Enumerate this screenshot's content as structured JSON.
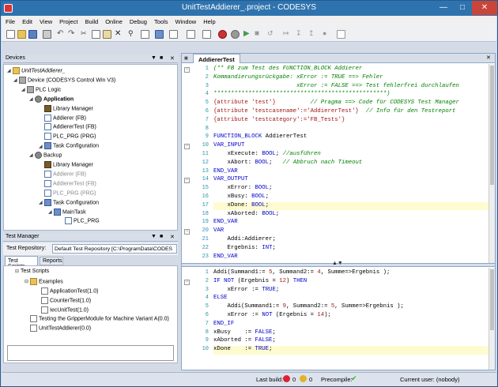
{
  "window": {
    "title": "UnitTestAddierer_.project - CODESYS"
  },
  "menu": [
    "File",
    "Edit",
    "View",
    "Project",
    "Build",
    "Online",
    "Debug",
    "Tools",
    "Window",
    "Help"
  ],
  "devices": {
    "title": "Devices",
    "items": [
      {
        "label": "UnitTestAddierer_",
        "icon": "project-icon",
        "italic": true
      },
      {
        "label": "Device (CODESYS Control Win V3)",
        "icon": "device-icon"
      },
      {
        "label": "PLC Logic",
        "icon": "plc-logic-icon"
      },
      {
        "label": "Application",
        "icon": "gear-icon",
        "bold": true
      },
      {
        "label": "Library Manager",
        "icon": "library-icon"
      },
      {
        "label": "Addierer (FB)",
        "icon": "pou-icon"
      },
      {
        "label": "AddiererTest (FB)",
        "icon": "pou-icon"
      },
      {
        "label": "PLC_PRG (PRG)",
        "icon": "pou-icon"
      },
      {
        "label": "Task Configuration",
        "icon": "task-icon"
      },
      {
        "label": "Backup",
        "icon": "gear-icon"
      },
      {
        "label": "Library Manager",
        "icon": "library-icon"
      },
      {
        "label": "Addierer (FB)",
        "icon": "pou-icon",
        "grey": true
      },
      {
        "label": "AddiererTest (FB)",
        "icon": "pou-icon",
        "grey": true
      },
      {
        "label": "PLC_PRG (PRG)",
        "icon": "pou-icon",
        "grey": true
      },
      {
        "label": "Task Configuration",
        "icon": "task-icon"
      },
      {
        "label": "MainTask",
        "icon": "task-icon"
      },
      {
        "label": "PLC_PRG",
        "icon": "pou-icon"
      }
    ]
  },
  "test_manager": {
    "title": "Test Manager",
    "repo_label": "Test Repository:",
    "repo_value": "Default Test Repository [C:\\ProgramData\\CODES",
    "tabs": [
      "Test Scripts",
      "Reports"
    ],
    "items": [
      {
        "label": "Test Scripts"
      },
      {
        "label": "Examples"
      },
      {
        "label": "ApplicationTest(1.0)"
      },
      {
        "label": "CounterTest(1.0)"
      },
      {
        "label": "IecUnitTest(1.0)"
      },
      {
        "label": "Testing the GripperModule for Machine Variant A(0.0)"
      },
      {
        "label": "UnitTestAddierer(0.0)"
      }
    ]
  },
  "editor": {
    "tab": "AddiererTest",
    "decl_lines": [
      {
        "n": "1",
        "html": "<span class='cmt'>(** FB zum Test des FUNCTION_BLOCK Addierer</span>"
      },
      {
        "n": "2",
        "html": "<span class='cmt'>Kommandierungsrückgabe: xError := TRUE ==> Fehler</span>"
      },
      {
        "n": "3",
        "html": "<span class='cmt'>                        xError := FALSE ==> Test fehlerfrei durchlaufen</span>"
      },
      {
        "n": "4",
        "html": "<span class='cmt'>**************************************************)</span>"
      },
      {
        "n": "5",
        "html": "<span class='str'>{attribute 'test'}</span>          <span class='cmt'>// Pragma ==> Code für CODESYS Test Manager</span>"
      },
      {
        "n": "6",
        "html": "<span class='str'>{attribute 'testcasename':='AddiererTest'}</span>  <span class='cmt'>// Info für den Testreport</span>"
      },
      {
        "n": "7",
        "html": "<span class='str'>{attribute 'testcategory':='FB_Tests'}</span>"
      },
      {
        "n": "8",
        "html": ""
      },
      {
        "n": "9",
        "html": "<span class='kw'>FUNCTION_BLOCK</span> AddiererTest"
      },
      {
        "n": "10",
        "html": "<span class='kw'>VAR_INPUT</span>"
      },
      {
        "n": "11",
        "html": "    xExecute: <span class='kw'>BOOL</span>; <span class='cmt'>//ausführen</span>"
      },
      {
        "n": "12",
        "html": "    xAbort: <span class='kw'>BOOL</span>;   <span class='cmt'>// Abbruch nach Timeout</span>"
      },
      {
        "n": "13",
        "html": "<span class='kw'>END_VAR</span>"
      },
      {
        "n": "14",
        "html": "<span class='kw'>VAR_OUTPUT</span>"
      },
      {
        "n": "15",
        "html": "    xError: <span class='kw'>BOOL</span>;"
      },
      {
        "n": "16",
        "html": "    xBusy: <span class='kw'>BOOL</span>;"
      },
      {
        "n": "17",
        "html": "    xDone: <span class='kw'>BOOL</span>;",
        "hl": true
      },
      {
        "n": "18",
        "html": "    xAborted: <span class='kw'>BOOL</span>;"
      },
      {
        "n": "19",
        "html": "<span class='kw'>END_VAR</span>"
      },
      {
        "n": "20",
        "html": "<span class='kw'>VAR</span>"
      },
      {
        "n": "21",
        "html": "    Addi:Addierer;"
      },
      {
        "n": "22",
        "html": "    Ergebnis: <span class='kw'>INT</span>;"
      },
      {
        "n": "23",
        "html": "<span class='kw'>END_VAR</span>"
      }
    ],
    "impl_lines": [
      {
        "n": "1",
        "html": "Addi(Summand1:= <span class='num'>5</span>, Summand2:= <span class='num'>4</span>, Summe=>Ergebnis );"
      },
      {
        "n": "2",
        "html": "<span class='kw'>IF NOT</span> (Ergebnis = <span class='num'>12</span>) <span class='kw'>THEN</span>"
      },
      {
        "n": "3",
        "html": "    xError := <span class='kw'>TRUE</span>;"
      },
      {
        "n": "4",
        "html": "<span class='kw'>ELSE</span>"
      },
      {
        "n": "5",
        "html": "    Addi(Summand1:= <span class='num'>9</span>, Summand2:= <span class='num'>5</span>, Summe=>Ergebnis );"
      },
      {
        "n": "6",
        "html": "    xError := <span class='kw'>NOT</span> (Ergebnis = <span class='num'>14</span>);"
      },
      {
        "n": "7",
        "html": "<span class='kw'>END_IF</span>"
      },
      {
        "n": "8",
        "html": "xBusy    := <span class='kw'>FALSE</span>;"
      },
      {
        "n": "9",
        "html": "xAborted := <span class='kw'>FALSE</span>;"
      },
      {
        "n": "10",
        "html": "xDone    := <span class='kw'>TRUE</span>;",
        "hl": true
      }
    ]
  },
  "status": {
    "last_build_label": "Last build:",
    "errors": "0",
    "warnings": "0",
    "precompile_label": "Precompile:",
    "current_user": "Current user: (nobody)"
  }
}
